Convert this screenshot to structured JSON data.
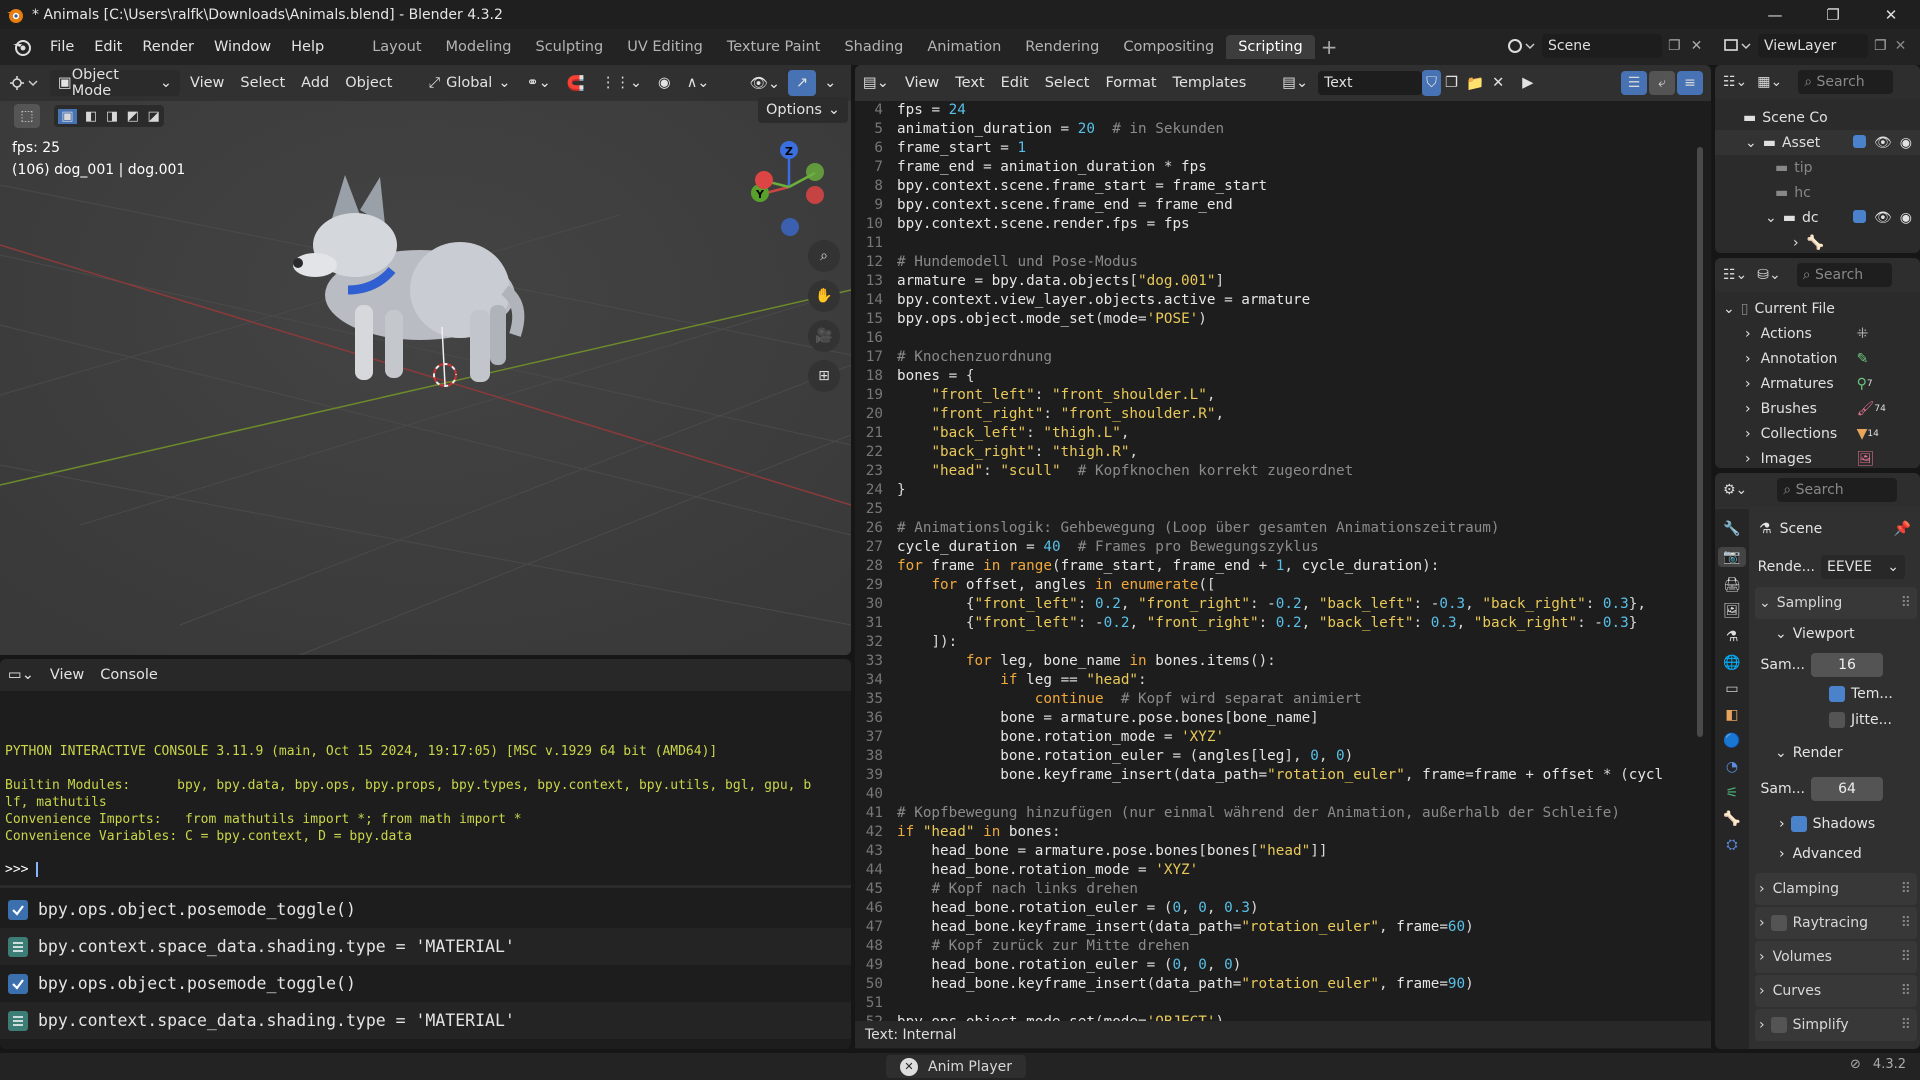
{
  "window": {
    "title": "* Animals [C:\\Users\\ralfk\\Downloads\\Animals.blend] - Blender 4.3.2",
    "controls": [
      "—",
      "❐",
      "✕"
    ]
  },
  "menu": [
    "File",
    "Edit",
    "Render",
    "Window",
    "Help"
  ],
  "workspaces": [
    "Layout",
    "Modeling",
    "Sculpting",
    "UV Editing",
    "Texture Paint",
    "Shading",
    "Animation",
    "Rendering",
    "Compositing",
    "Scripting"
  ],
  "active_workspace": "Scripting",
  "scene_field": "Scene",
  "viewlayer_field": "ViewLayer",
  "viewport": {
    "mode": "Object Mode",
    "menus": [
      "View",
      "Select",
      "Add",
      "Object"
    ],
    "transform": "Global",
    "options": "Options",
    "fps_text": "fps: 25",
    "object_text": "(106) dog_001 | dog.001",
    "gizmo": {
      "z": "Z",
      "y": "Y"
    }
  },
  "text_editor": {
    "menus": [
      "View",
      "Text",
      "Edit",
      "Select",
      "Format",
      "Templates"
    ],
    "datablock": "Text",
    "footer": "Text: Internal",
    "lines": [
      {
        "n": "4",
        "t": "fps = 24"
      },
      {
        "n": "5",
        "t": "animation_duration = 20  # in Sekunden"
      },
      {
        "n": "6",
        "t": "frame_start = 1"
      },
      {
        "n": "7",
        "t": "frame_end = animation_duration * fps"
      },
      {
        "n": "8",
        "t": "bpy.context.scene.frame_start = frame_start"
      },
      {
        "n": "9",
        "t": "bpy.context.scene.frame_end = frame_end"
      },
      {
        "n": "10",
        "t": "bpy.context.scene.render.fps = fps"
      },
      {
        "n": "11",
        "t": ""
      },
      {
        "n": "12",
        "t": "# Hundemodell und Pose-Modus"
      },
      {
        "n": "13",
        "t": "armature = bpy.data.objects[\"dog.001\"]"
      },
      {
        "n": "14",
        "t": "bpy.context.view_layer.objects.active = armature"
      },
      {
        "n": "15",
        "t": "bpy.ops.object.mode_set(mode='POSE')"
      },
      {
        "n": "16",
        "t": ""
      },
      {
        "n": "17",
        "t": "# Knochenzuordnung"
      },
      {
        "n": "18",
        "t": "bones = {"
      },
      {
        "n": "19",
        "t": "    \"front_left\": \"front_shoulder.L\","
      },
      {
        "n": "20",
        "t": "    \"front_right\": \"front_shoulder.R\","
      },
      {
        "n": "21",
        "t": "    \"back_left\": \"thigh.L\","
      },
      {
        "n": "22",
        "t": "    \"back_right\": \"thigh.R\","
      },
      {
        "n": "23",
        "t": "    \"head\": \"scull\"  # Kopfknochen korrekt zugeordnet"
      },
      {
        "n": "24",
        "t": "}"
      },
      {
        "n": "25",
        "t": ""
      },
      {
        "n": "26",
        "t": "# Animationslogik: Gehbewegung (Loop über gesamten Animationszeitraum)"
      },
      {
        "n": "27",
        "t": "cycle_duration = 40  # Frames pro Bewegungszyklus"
      },
      {
        "n": "28",
        "t": "for frame in range(frame_start, frame_end + 1, cycle_duration):"
      },
      {
        "n": "29",
        "t": "    for offset, angles in enumerate(["
      },
      {
        "n": "30",
        "t": "        {\"front_left\": 0.2, \"front_right\": -0.2, \"back_left\": -0.3, \"back_right\": 0.3},"
      },
      {
        "n": "31",
        "t": "        {\"front_left\": -0.2, \"front_right\": 0.2, \"back_left\": 0.3, \"back_right\": -0.3}"
      },
      {
        "n": "32",
        "t": "    ]):"
      },
      {
        "n": "33",
        "t": "        for leg, bone_name in bones.items():"
      },
      {
        "n": "34",
        "t": "            if leg == \"head\":"
      },
      {
        "n": "35",
        "t": "                continue  # Kopf wird separat animiert"
      },
      {
        "n": "36",
        "t": "            bone = armature.pose.bones[bone_name]"
      },
      {
        "n": "37",
        "t": "            bone.rotation_mode = 'XYZ'"
      },
      {
        "n": "38",
        "t": "            bone.rotation_euler = (angles[leg], 0, 0)"
      },
      {
        "n": "39",
        "t": "            bone.keyframe_insert(data_path=\"rotation_euler\", frame=frame + offset * (cycl"
      },
      {
        "n": "40",
        "t": ""
      },
      {
        "n": "41",
        "t": "# Kopfbewegung hinzufügen (nur einmal während der Animation, außerhalb der Schleife)"
      },
      {
        "n": "42",
        "t": "if \"head\" in bones:"
      },
      {
        "n": "43",
        "t": "    head_bone = armature.pose.bones[bones[\"head\"]]"
      },
      {
        "n": "44",
        "t": "    head_bone.rotation_mode = 'XYZ'"
      },
      {
        "n": "45",
        "t": "    # Kopf nach links drehen"
      },
      {
        "n": "46",
        "t": "    head_bone.rotation_euler = (0, 0, 0.3)"
      },
      {
        "n": "47",
        "t": "    head_bone.keyframe_insert(data_path=\"rotation_euler\", frame=60)"
      },
      {
        "n": "48",
        "t": "    # Kopf zurück zur Mitte drehen"
      },
      {
        "n": "49",
        "t": "    head_bone.rotation_euler = (0, 0, 0)"
      },
      {
        "n": "50",
        "t": "    head_bone.keyframe_insert(data_path=\"rotation_euler\", frame=90)"
      },
      {
        "n": "51",
        "t": ""
      },
      {
        "n": "52",
        "t": "bpy.ops.object.mode_set(mode='OBJECT')"
      }
    ]
  },
  "console": {
    "menus": [
      "View",
      "Console"
    ],
    "banner": [
      "PYTHON INTERACTIVE CONSOLE 3.11.9 (main, Oct 15 2024, 19:17:05) [MSC v.1929 64 bit (AMD64)]",
      "",
      "Builtin Modules:      bpy, bpy.data, bpy.ops, bpy.props, bpy.types, bpy.context, bpy.utils, bgl, gpu, b",
      "lf, mathutils",
      "Convenience Imports:   from mathutils import *; from math import *",
      "Convenience Variables: C = bpy.context, D = bpy.data"
    ],
    "prompt": ">>> ",
    "info_log": [
      {
        "icon": "check",
        "text": "bpy.ops.object.posemode_toggle()"
      },
      {
        "icon": "props",
        "text": "bpy.context.space_data.shading.type = 'MATERIAL'"
      },
      {
        "icon": "check",
        "text": "bpy.ops.object.posemode_toggle()"
      },
      {
        "icon": "props",
        "text": "bpy.context.space_data.shading.type = 'MATERIAL'"
      }
    ]
  },
  "outliner": {
    "search": "Search",
    "rows": [
      "Scene Co",
      "Asset",
      "tip",
      "hc",
      "dc",
      ""
    ]
  },
  "blendfile": {
    "search": "Search",
    "root": "Current File",
    "items": [
      {
        "label": "Actions",
        "count": ""
      },
      {
        "label": "Annotation",
        "count": ""
      },
      {
        "label": "Armatures",
        "count": "7"
      },
      {
        "label": "Brushes",
        "count": "74"
      },
      {
        "label": "Collections",
        "count": "14"
      },
      {
        "label": "Images",
        "count": ""
      }
    ]
  },
  "properties": {
    "search": "Search",
    "scene_label": "Scene",
    "render_engine_label": "Rende...",
    "render_engine": "EEVEE",
    "sampling": "Sampling",
    "viewport": "Viewport",
    "viewport_samples_label": "Sam...",
    "viewport_samples": "16",
    "temporal": "Tem...",
    "jitter": "Jitte...",
    "render": "Render",
    "render_samples_label": "Sam...",
    "render_samples": "64",
    "shadows": "Shadows",
    "advanced": "Advanced",
    "sections": [
      "Clamping",
      "Raytracing",
      "Volumes",
      "Curves",
      "Simplify"
    ]
  },
  "statusbar": {
    "anim_player": "Anim Player",
    "version": "4.3.2"
  },
  "colors": {
    "accent": "#4772b3",
    "active_checkbox": "#4a82cc",
    "python_keyword": "#f0a83c",
    "python_string": "#e8c95a",
    "python_number": "#58c0e8",
    "console_text": "#c9d64a"
  }
}
